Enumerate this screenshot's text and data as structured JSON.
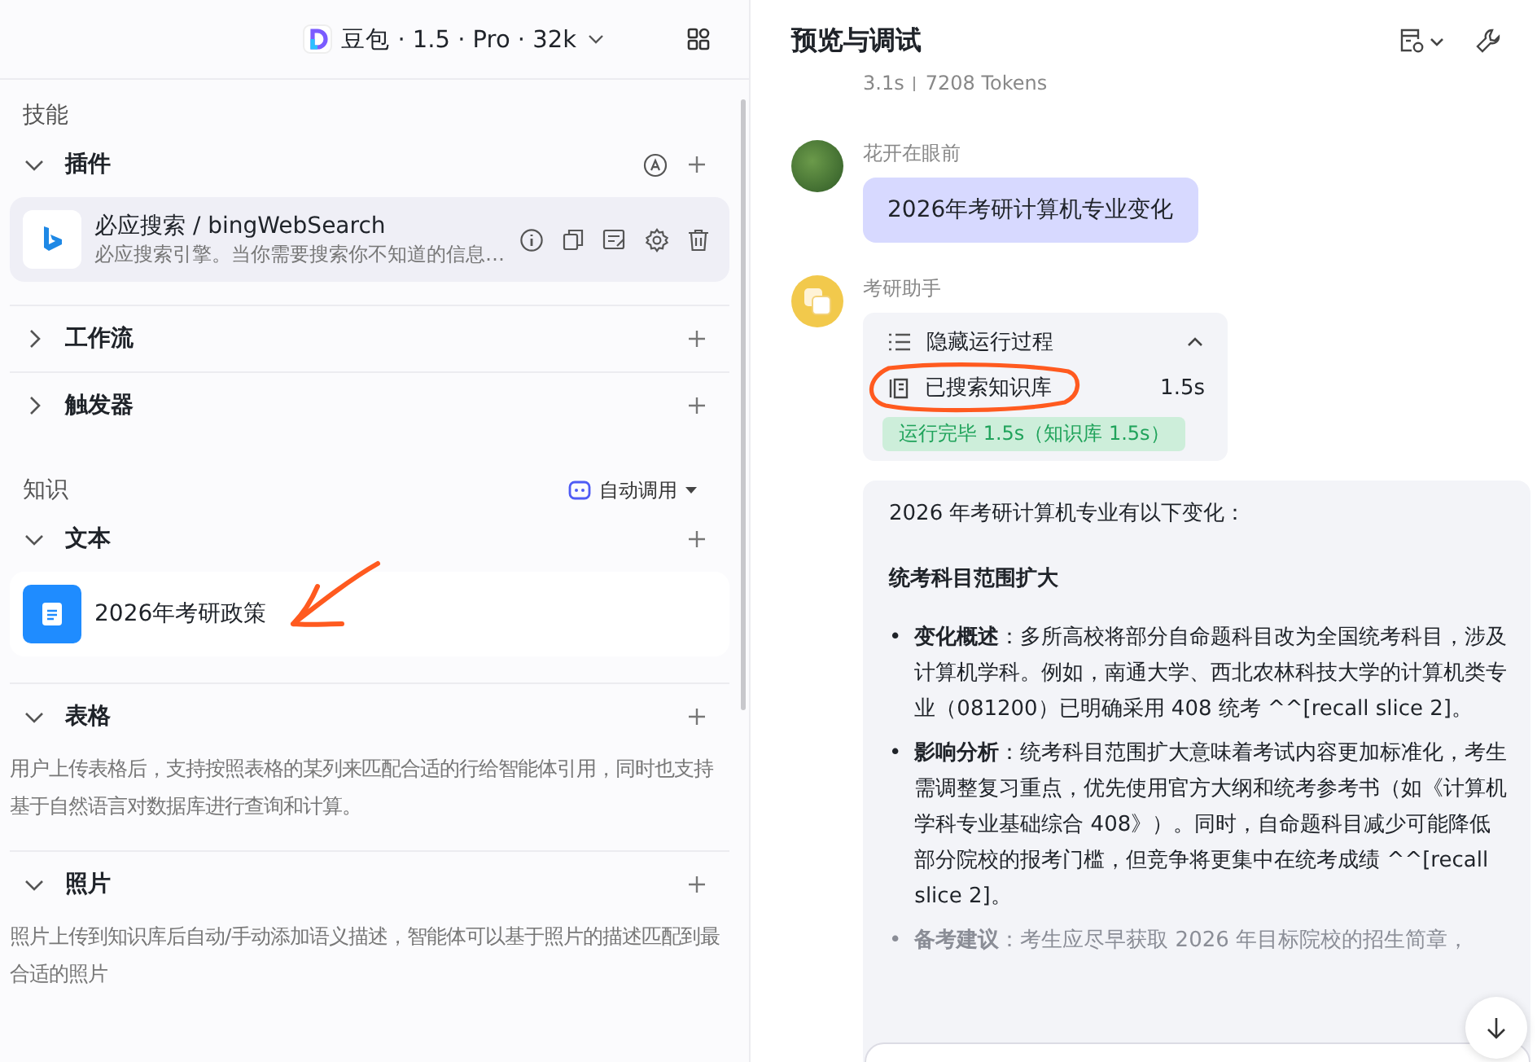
{
  "header": {
    "model": "豆包 · 1.5 · Pro · 32k"
  },
  "skills": {
    "title": "技能",
    "sections": [
      {
        "label": "插件",
        "expanded": true,
        "items": [
          {
            "name": "必应搜索 / bingWebSearch",
            "description": "必应搜索引擎。当你需要搜索你不知道的信息…"
          }
        ]
      },
      {
        "label": "工作流",
        "expanded": false
      },
      {
        "label": "触发器",
        "expanded": false
      }
    ]
  },
  "knowledge": {
    "title": "知识",
    "mode": "自动调用",
    "sections": [
      {
        "label": "文本",
        "expanded": true,
        "items": [
          {
            "name": "2026年考研政策"
          }
        ]
      },
      {
        "label": "表格",
        "expanded": true,
        "description": "用户上传表格后，支持按照表格的某列来匹配合适的行给智能体引用，同时也支持基于自然语言对数据库进行查询和计算。"
      },
      {
        "label": "照片",
        "expanded": true,
        "description": "照片上传到知识库后自动/手动添加语义描述，智能体可以基于照片的描述匹配到最合适的照片"
      }
    ]
  },
  "preview": {
    "title": "预览与调试",
    "meta": [
      "3.1s",
      "7208 Tokens"
    ],
    "messages": [
      {
        "kind": "user",
        "sender": "花开在眼前",
        "text": "2026年考研计算机专业变化"
      },
      {
        "kind": "assistant",
        "sender": "考研助手",
        "process": {
          "toggle": "隐藏运行过程",
          "expanded": true,
          "steps": [
            {
              "label": "已搜索知识库",
              "time": "1.5s"
            }
          ],
          "status": "运行完毕 1.5s（知识库 1.5s）"
        },
        "response": {
          "intro": "2026 年考研计算机专业有以下变化：",
          "heading": "统考科目范围扩大",
          "bullets": [
            {
              "marker": "•",
              "text": "**变化概述**：多所高校将部分自命题科目改为全国统考科目，涉及计算机学科。例如，南通大学、西北农林科技大学的计算机类专业（081200）已明确采用 408 统考 ^^[recall slice 2]。",
              "faded": false
            },
            {
              "marker": "•",
              "text": "**影响分析**：统考科目范围扩大意味着考试内容更加标准化，考生需调整复习重点，优先使用官方大纲和统考参考书（如《计算机学科专业基础综合 408》）。同时，自命题科目减少可能降低部分院校的报考门槛，但竞争将更集中在统考成绩 ^^[recall slice 2]。",
              "faded": false
            },
            {
              "marker": "•",
              "text": "**备考建议**：考生应尽早获取 2026 年目标院校的招生简章，",
              "faded": true
            }
          ]
        }
      }
    ]
  }
}
